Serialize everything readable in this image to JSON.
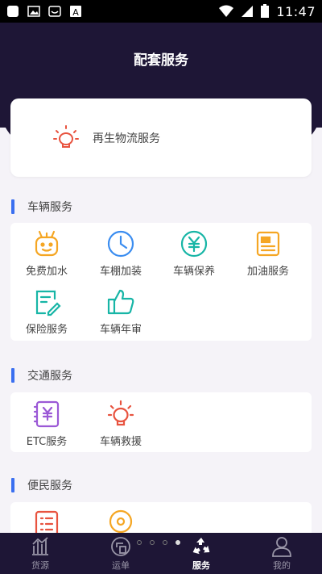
{
  "status_bar": {
    "time": "11:47",
    "icons": [
      "image-icon",
      "photo-icon",
      "smiley-icon",
      "text-icon",
      "wifi-icon",
      "signal-icon",
      "battery-icon"
    ]
  },
  "header": {
    "title": "配套服务"
  },
  "recycle": {
    "label": "再生物流服务",
    "icon": "lightbulb-icon"
  },
  "sections": {
    "vehicle": {
      "title": "车辆服务",
      "items": [
        {
          "label": "免费加水",
          "icon": "water-bot-icon"
        },
        {
          "label": "车棚加装",
          "icon": "clock-icon"
        },
        {
          "label": "车辆保养",
          "icon": "yen-circle-icon"
        },
        {
          "label": "加油服务",
          "icon": "document-icon"
        },
        {
          "label": "保险服务",
          "icon": "edit-doc-icon"
        },
        {
          "label": "车辆年审",
          "icon": "thumbs-up-icon"
        }
      ]
    },
    "traffic": {
      "title": "交通服务",
      "items": [
        {
          "label": "ETC服务",
          "icon": "etc-card-icon"
        },
        {
          "label": "车辆救援",
          "icon": "lightbulb-icon"
        }
      ]
    },
    "convenience": {
      "title": "便民服务",
      "items": [
        {
          "label": "",
          "icon": "list-icon"
        },
        {
          "label": "",
          "icon": "location-icon"
        }
      ]
    }
  },
  "nav": {
    "items": [
      {
        "label": "货源",
        "icon": "chart-icon"
      },
      {
        "label": "运单",
        "icon": "waybill-icon"
      },
      {
        "label": "服务",
        "icon": "recycle-icon"
      },
      {
        "label": "我的",
        "icon": "user-icon"
      }
    ],
    "active": "服务"
  },
  "colors": {
    "header": "#1e1636",
    "accent": "#3a6ff0",
    "orange": "#f5a623",
    "blue": "#3b8df0",
    "teal": "#17b5a6",
    "red": "#e8533f",
    "purple": "#9b59d6"
  }
}
